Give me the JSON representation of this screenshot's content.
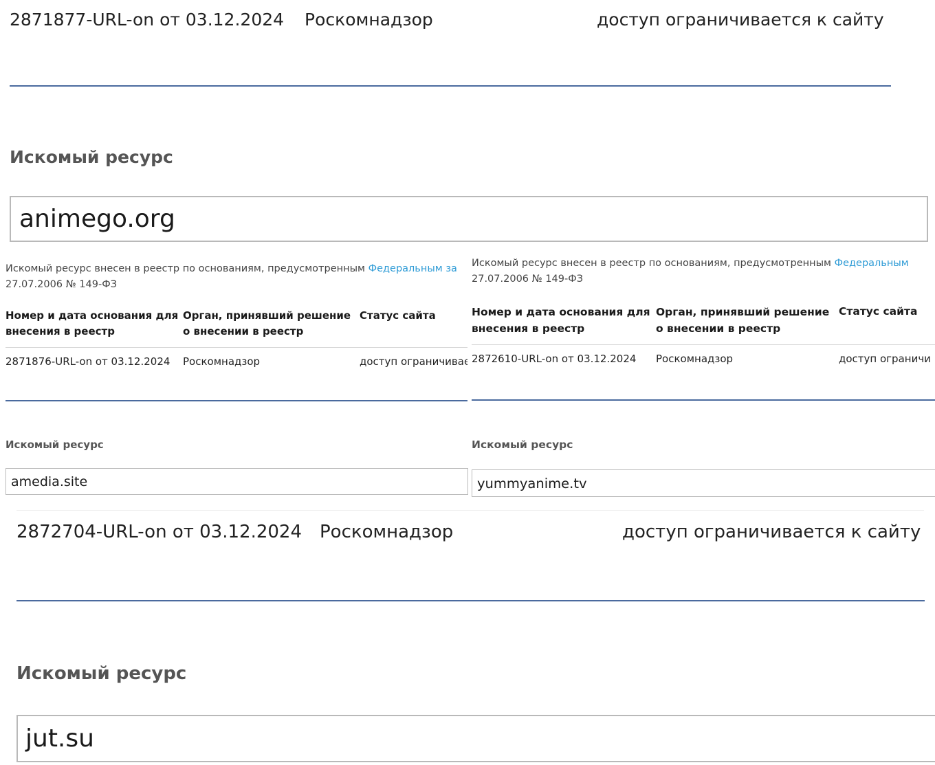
{
  "top_block": {
    "row": {
      "number_date": "2871877-URL-on от 03.12.2024",
      "authority": "Роскомнадзор",
      "status": "доступ ограничивается к сайту"
    },
    "resource_heading": "Искомый ресурс",
    "resource_value": "animego.org"
  },
  "left_block": {
    "note_prefix": "Искомый ресурс внесен в реестр по основаниям, предусмотренным ",
    "note_link": "Федеральным за",
    "note_line2": "27.07.2006 № 149-ФЗ",
    "columns": {
      "number_date": "Номер и дата основания для внесения в реестр",
      "authority": "Орган, принявший решение о внесении в реестр",
      "status": "Статус сайта"
    },
    "row": {
      "number_date": "2871876-URL-on от 03.12.2024",
      "authority": "Роскомнадзор",
      "status": "доступ ограничивае"
    },
    "resource_heading": "Искомый ресурс",
    "resource_value": "amedia.site"
  },
  "right_block": {
    "note_prefix": "Искомый ресурс внесен в реестр по основаниям, предусмотренным ",
    "note_link": "Федеральным",
    "note_line2": "27.07.2006 № 149-ФЗ",
    "columns": {
      "number_date": "Номер и дата основания для внесения в реестр",
      "authority": "Орган, принявший решение о внесении в реестр",
      "status": "Статус сайта"
    },
    "row": {
      "number_date": "2872610-URL-on от 03.12.2024",
      "authority": "Роскомнадзор",
      "status": "доступ ограничи"
    },
    "resource_heading": "Искомый ресурс",
    "resource_value": "yummyanime.tv"
  },
  "bottom_block": {
    "row": {
      "number_date": "2872704-URL-on от 03.12.2024",
      "authority": "Роскомнадзор",
      "status": "доступ ограничивается к сайту"
    },
    "resource_heading": "Искомый ресурс",
    "resource_value": "jut.su"
  },
  "colors": {
    "rule": "#4a6a9e",
    "link": "#2e9bd6",
    "input_border": "#b9b9b9"
  }
}
